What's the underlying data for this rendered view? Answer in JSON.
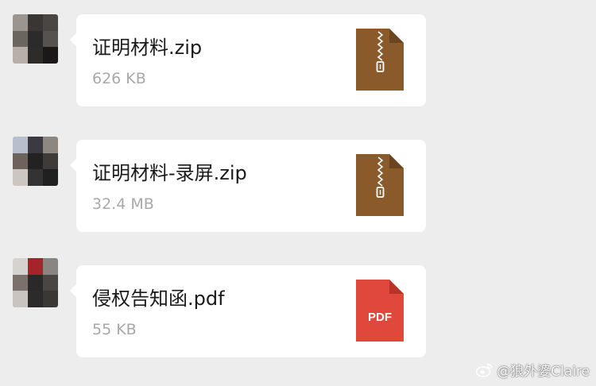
{
  "messages": [
    {
      "file_name": "证明材料.zip",
      "file_size": "626 KB",
      "file_icon": "zip-archive-icon",
      "icon_color": "#8b5a2b"
    },
    {
      "file_name": "证明材料-录屏.zip",
      "file_size": "32.4 MB",
      "file_icon": "zip-archive-icon",
      "icon_color": "#8b5a2b"
    },
    {
      "file_name": "侵权告知函.pdf",
      "file_size": "55 KB",
      "file_icon": "pdf-icon",
      "icon_color": "#e0483b",
      "icon_label": "PDF"
    }
  ],
  "watermark": {
    "text": "@狼外婆Claire",
    "icon": "weibo-logo-icon"
  },
  "colors": {
    "background": "#ededed",
    "bubble": "#ffffff",
    "file_name": "#1a1a1a",
    "file_size": "#a8a8a8"
  }
}
